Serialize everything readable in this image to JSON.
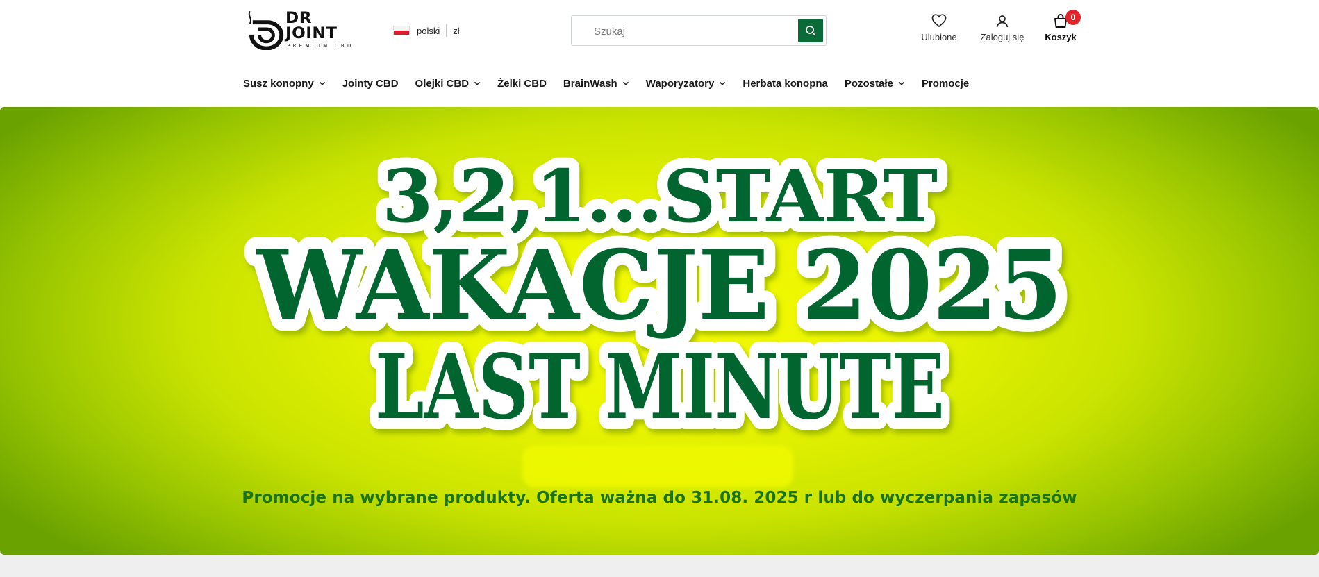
{
  "brand": {
    "name": "DR JOINT",
    "tagline": "PREMIUM CBD"
  },
  "header": {
    "language": "polski",
    "currency": "zł",
    "search_placeholder": "Szukaj",
    "favorites_label": "Ulubione",
    "login_label": "Zaloguj się",
    "cart_label": "Koszyk",
    "cart_count": "0"
  },
  "nav": {
    "items": [
      {
        "label": "Susz konopny",
        "has_dropdown": true
      },
      {
        "label": "Jointy CBD",
        "has_dropdown": false
      },
      {
        "label": "Olejki CBD",
        "has_dropdown": true
      },
      {
        "label": "Żelki CBD",
        "has_dropdown": false
      },
      {
        "label": "BrainWash",
        "has_dropdown": true
      },
      {
        "label": "Waporyzatory",
        "has_dropdown": true
      },
      {
        "label": "Herbata konopna",
        "has_dropdown": false
      },
      {
        "label": "Pozostałe",
        "has_dropdown": true
      },
      {
        "label": "Promocje",
        "has_dropdown": false
      }
    ]
  },
  "banner": {
    "line1": "3,2,1...START",
    "line2": "WAKACJE 2025",
    "line3": "LAST MINUTE",
    "subtitle": "Promocje na wybrane produkty. Oferta ważna do 31.08. 2025 r lub do wyczerpania zapasów"
  },
  "colors": {
    "brand_green": "#0a6b39",
    "headline_green": "#05652f",
    "subtitle_green": "#187319",
    "badge_red": "#e3262c",
    "banner_yellow": "#f5fb00"
  },
  "icons": {
    "search": "search-icon",
    "favorites": "heart-icon",
    "login": "user-icon",
    "cart": "cart-icon",
    "dropdown": "chevron-down-icon",
    "language": "poland-flag-icon"
  }
}
